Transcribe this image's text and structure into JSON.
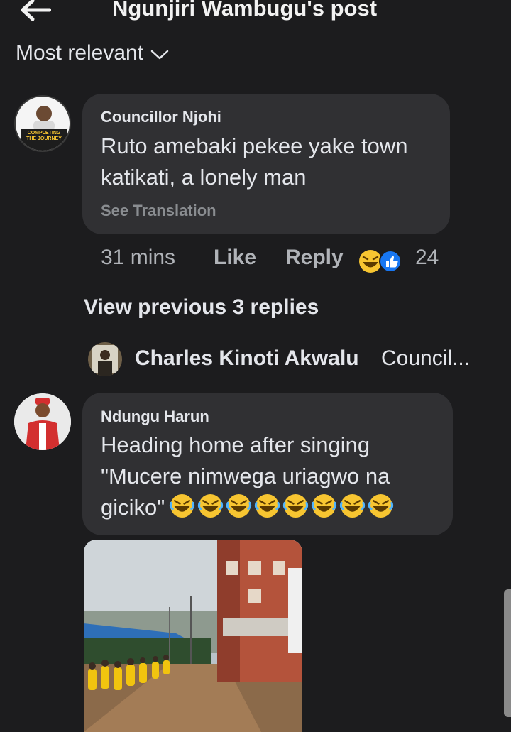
{
  "header": {
    "title": "Ngunjiri Wambugu's post",
    "sort_label": "Most relevant"
  },
  "comment1": {
    "author": "Councillor Njohi",
    "text_line1": "Ruto amebaki pekee yake town",
    "text_line2": "katikati, a lonely man",
    "see_translation": "See Translation",
    "time": "31 mins",
    "like_label": "Like",
    "reply_label": "Reply",
    "reaction_count": "24",
    "avatar_caption": "COMPLETING THE JOURNEY"
  },
  "replies": {
    "view_previous": "View previous 3 replies",
    "latest_author": "Charles Kinoti Akwalu",
    "latest_snippet": "Council..."
  },
  "comment2": {
    "author": "Ndungu Harun",
    "text_line1": "Heading home after singing",
    "text_line2": "\"Mucere nimwega uriagwo na",
    "text_line3": "giciko\"",
    "emoji_count": 8
  },
  "colors": {
    "background": "#1c1c1e",
    "bubble": "#303033",
    "secondary_text": "#b0b3b8",
    "like_blue": "#1877f2",
    "emoji_yellow": "#f7c531"
  },
  "icons": [
    "back-arrow-icon",
    "chevron-down-icon",
    "laughing-emoji-icon",
    "like-reaction-icon"
  ]
}
